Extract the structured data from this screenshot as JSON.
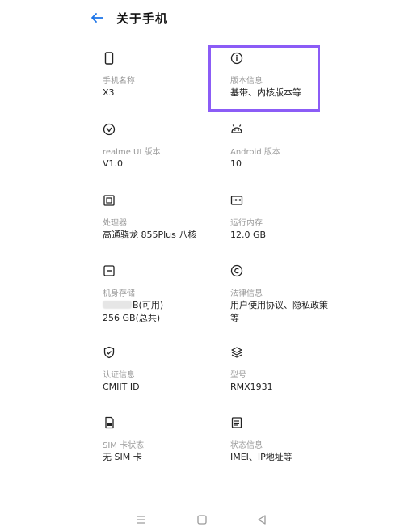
{
  "header": {
    "title": "关于手机"
  },
  "items": [
    {
      "label": "手机名称",
      "value": "X3"
    },
    {
      "label": "版本信息",
      "value": "基带、内核版本等"
    },
    {
      "label": "realme UI 版本",
      "value": "V1.0"
    },
    {
      "label": "Android 版本",
      "value": "10"
    },
    {
      "label": "处理器",
      "value": "高通骁龙 855Plus 八核"
    },
    {
      "label": "运行内存",
      "value": "12.0 GB"
    },
    {
      "label": "机身存储",
      "value": "B(可用)",
      "value2": "256 GB(总共)"
    },
    {
      "label": "法律信息",
      "value": "用户使用协议、隐私政策",
      "value2": "等"
    },
    {
      "label": "认证信息",
      "value": "CMIIT ID"
    },
    {
      "label": "型号",
      "value": "RMX1931"
    },
    {
      "label": "SIM 卡状态",
      "value": "无 SIM 卡"
    },
    {
      "label": "状态信息",
      "value": "IMEI、IP地址等"
    }
  ],
  "colors": {
    "accent": "#1a73e8",
    "highlight": "#8b5cf6",
    "label": "#9a9a9a"
  }
}
